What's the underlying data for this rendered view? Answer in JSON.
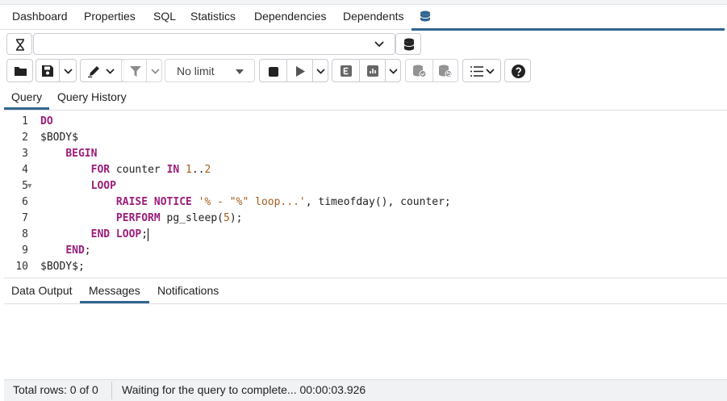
{
  "top_tabs": [
    "Dashboard",
    "Properties",
    "SQL",
    "Statistics",
    "Dependencies",
    "Dependents"
  ],
  "active_top_tab_icon": "database-query-icon",
  "connection": {
    "selected": "",
    "hourglass_icon": "hourglass-icon",
    "dropdown_icon": "chevron-down-icon",
    "db_icon": "database-icon"
  },
  "toolbar": {
    "limit_selected": "No limit",
    "icons": [
      "folder-icon",
      "save-icon",
      "chevron-down-icon",
      "edit-pen-icon",
      "chevron-down-icon",
      "filter-icon",
      "chevron-down-icon",
      "stop-icon",
      "play-icon",
      "chevron-down-icon",
      "explain-icon",
      "explain-analyze-icon",
      "chevron-down-icon",
      "commit-icon",
      "rollback-icon",
      "macros-icon",
      "help-icon"
    ]
  },
  "query_tabs": {
    "query": "Query",
    "history": "Query History"
  },
  "editor": {
    "line_numbers": [
      "1",
      "2",
      "3",
      "4",
      "5",
      "6",
      "7",
      "8",
      "9",
      "10"
    ],
    "lines": [
      "DO",
      "$BODY$",
      "    BEGIN",
      "        FOR counter IN 1..2",
      "        LOOP",
      "            RAISE NOTICE '% - \"%\" loop...', timeofday(), counter;",
      "            PERFORM pg_sleep(5);",
      "        END LOOP;",
      "    END;",
      "$BODY$;"
    ]
  },
  "output_tabs": {
    "data_output": "Data Output",
    "messages": "Messages",
    "notifications": "Notifications"
  },
  "status": {
    "total_rows": "Total rows: 0 of 0",
    "message": "Waiting for the query to complete... 00:00:03.926"
  },
  "colors": {
    "accent": "#326690",
    "keyword": "#9c1d7b",
    "literal": "#a55b1a"
  }
}
